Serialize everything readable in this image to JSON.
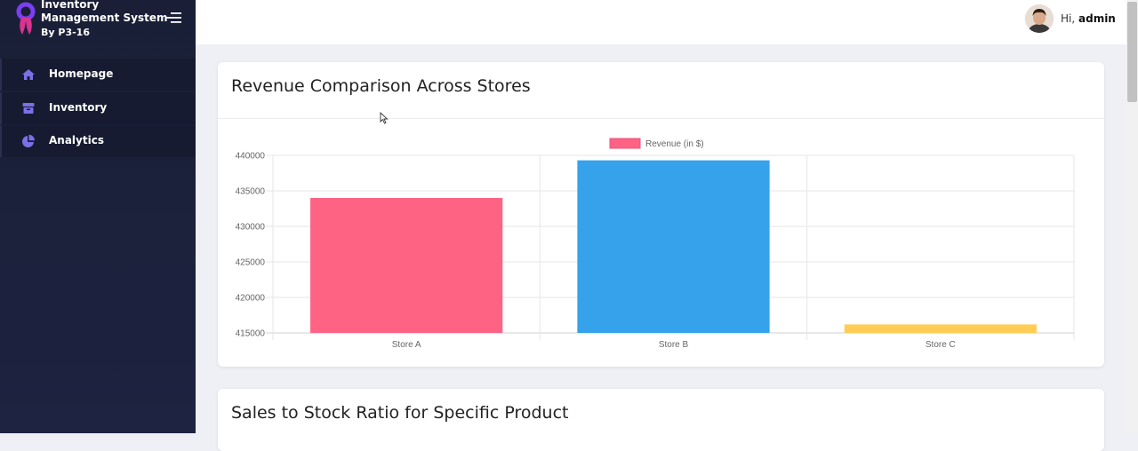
{
  "sidebar": {
    "brand_title": "Inventory Management System",
    "brand_subtitle": "By P3-16",
    "items": [
      {
        "label": "Homepage",
        "icon": "home-icon"
      },
      {
        "label": "Inventory",
        "icon": "box-icon"
      },
      {
        "label": "Analytics",
        "icon": "pie-chart-icon"
      }
    ]
  },
  "header": {
    "greeting_prefix": "Hi,",
    "username": "admin"
  },
  "cards": [
    {
      "title": "Revenue Comparison Across Stores"
    },
    {
      "title": "Sales to Stock Ratio for Specific Product"
    }
  ],
  "colors": {
    "accent": "#6c63ff",
    "sidebar_bg": "#1b2038",
    "store_a": "#ff6384",
    "store_b": "#36a2eb",
    "store_c": "#ffcd56"
  },
  "chart_data": {
    "type": "bar",
    "categories": [
      "Store A",
      "Store B",
      "Store C"
    ],
    "series": [
      {
        "name": "Revenue (in $)",
        "values": [
          434000,
          439300,
          416200
        ]
      }
    ],
    "bar_colors": [
      "#ff6384",
      "#36a2eb",
      "#ffcd56"
    ],
    "ylim": [
      415000,
      440000
    ],
    "yticks": [
      440000,
      435000,
      430000,
      425000,
      420000,
      415000
    ],
    "grid": true,
    "legend": "top-center"
  }
}
